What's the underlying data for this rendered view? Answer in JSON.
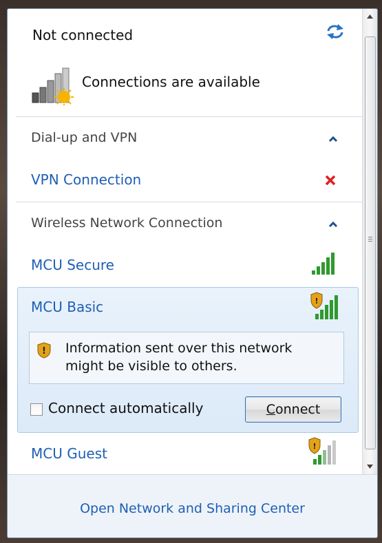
{
  "header": {
    "status": "Not connected",
    "connections_text": "Connections are available"
  },
  "dialup_group": {
    "title": "Dial-up and VPN",
    "items": [
      {
        "label": "VPN Connection"
      }
    ]
  },
  "wireless_group": {
    "title": "Wireless Network Connection",
    "items": [
      {
        "label": "MCU Secure"
      },
      {
        "label": "MCU Basic"
      },
      {
        "label": "MCU Guest"
      }
    ]
  },
  "selected_network": {
    "warning": "Information sent over this network might be visible to others.",
    "auto_connect_label": "Connect automatically",
    "auto_connect_checked": false,
    "connect_label": "Connect"
  },
  "footer": {
    "link": "Open Network and Sharing Center"
  },
  "colors": {
    "link": "#1e5fb4",
    "selection_bg": "#dceaf8",
    "signal_green": "#2e9a2e"
  },
  "icons": {
    "refresh": "refresh-icon",
    "network_status": "network-available-icon",
    "close": "red-x-icon",
    "shield": "security-shield-icon"
  }
}
